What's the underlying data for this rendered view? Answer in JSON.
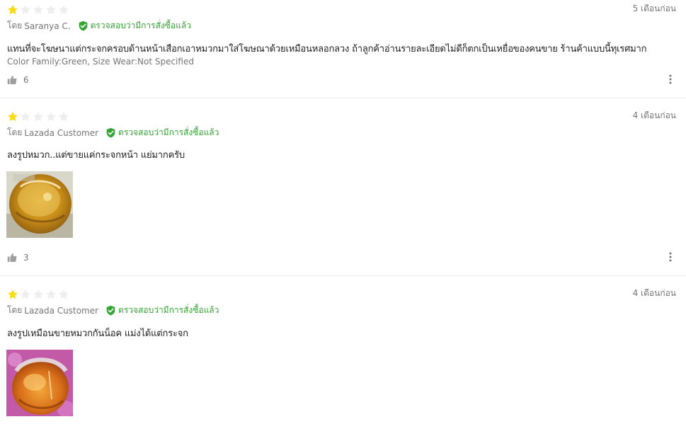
{
  "reviews": [
    {
      "rating": 1,
      "max_rating": 5,
      "date": "5 เดือนก่อน",
      "by_label": "โดย",
      "author": "Saranya C.",
      "verified_label": "ตรวจสอบว่ามีการสั่งซื้อแล้ว",
      "content": "แทนที่จะโฆษนาแต่กระจกครอบด้านหน้าเสือกเอาหมวกมาใส่โฆษณาด้วยเหมือนหลอกลวง ถ้าลูกค้าอ่านรายละเอียดไม่ดีก็ตกเป็นเหยื่อของคนขาย ร้านค้าแบบนี้ทุเรศมาก",
      "sku": "Color Family:Green, Size Wear:Not Specified",
      "likes": "6"
    },
    {
      "rating": 1,
      "max_rating": 5,
      "date": "4 เดือนก่อน",
      "by_label": "โดย",
      "author": "Lazada Customer",
      "verified_label": "ตรวจสอบว่ามีการสั่งซื้อแล้ว",
      "content": "ลงรูปหมวก..แต่ขายแค่กระจกหน้า แย่มากครับ",
      "likes": "3"
    },
    {
      "rating": 1,
      "max_rating": 5,
      "date": "4 เดือนก่อน",
      "by_label": "โดย",
      "author": "Lazada Customer",
      "verified_label": "ตรวจสอบว่ามีการสั่งซื้อแล้ว",
      "content": "ลงรูปเหมือนขายหมวกกันน็อค แม่งได้แต่กระจก"
    }
  ],
  "colors": {
    "star_filled": "#fadb14",
    "star_empty": "#eeeeee",
    "verified": "#33a532",
    "muted_text": "#757575"
  },
  "icons": {
    "rating": "star-icon",
    "verified": "verified-shield-check-icon",
    "like": "thumbs-up-icon",
    "more": "more-vertical-icon"
  }
}
